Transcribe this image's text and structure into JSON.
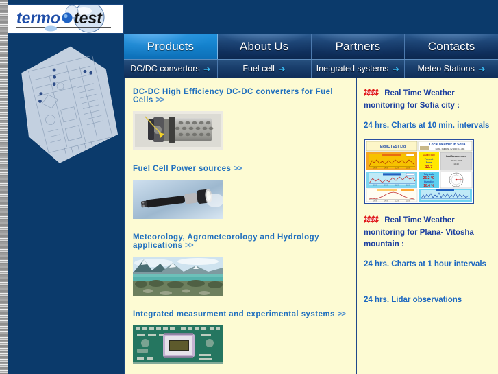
{
  "site": {
    "logo_text_1": "termo",
    "logo_text_2": "test",
    "left_graphic": "3d-schematic-diagram"
  },
  "nav": {
    "main": [
      {
        "label": "Products",
        "active": true,
        "name": "tab-products"
      },
      {
        "label": "About Us",
        "active": false,
        "name": "tab-about-us"
      },
      {
        "label": "Partners",
        "active": false,
        "name": "tab-partners"
      },
      {
        "label": "Contacts",
        "active": false,
        "name": "tab-contacts"
      }
    ],
    "sub": [
      {
        "label": "DC/DC convertors",
        "arrow": "➜",
        "name": "subtab-dcdc-convertors"
      },
      {
        "label": "Fuel cell",
        "arrow": "➜",
        "name": "subtab-fuel-cell"
      },
      {
        "label": "Inetgrated systems",
        "arrow": "➜",
        "name": "subtab-integrated-systems"
      },
      {
        "label": "Meteo Stations",
        "arrow": "➜",
        "name": "subtab-meteo-stations"
      }
    ]
  },
  "main": {
    "items": [
      {
        "link": "DC-DC  High  Efficiency  DC-DC  converters  for  Fuel  Cells",
        "chevron": ">>",
        "image": "dcdc-converter-photo"
      },
      {
        "link": "Fuel  Cell  Power  sources",
        "chevron": ">>",
        "image": "fuel-cell-flashlight-photo"
      },
      {
        "link": "Meteorology,  Agrometeorology  and  Hydrology  applications",
        "chevron": ">>",
        "image": "mountain-lake-photo"
      },
      {
        "link": "Integrated  measurment  and  experimental  systems",
        "chevron": ">>",
        "image": "circuit-board-photo"
      }
    ]
  },
  "sidebar": {
    "new_badge": "NEW",
    "block1": {
      "title": "Real Time Weather monitoring for Sofia city :",
      "sub": "24 hrs. Charts  at 10 min. intervals",
      "image": "weather-dashboard-thumbnail"
    },
    "block2": {
      "title": "Real Time Weather monitoring for Plana- Vitosha mountain :",
      "sub1": "24 hrs. Charts  at 1 hour intervals",
      "sub2": "24 hrs. Lidar observations"
    }
  },
  "colors": {
    "navy": "#0b3a6b",
    "active_tab": "#1482cd",
    "panel_bg": "#fdfbd3",
    "link_blue": "#1f6fbe",
    "heading_blue": "#1c3fa0",
    "badge_red": "#e01b1b"
  }
}
